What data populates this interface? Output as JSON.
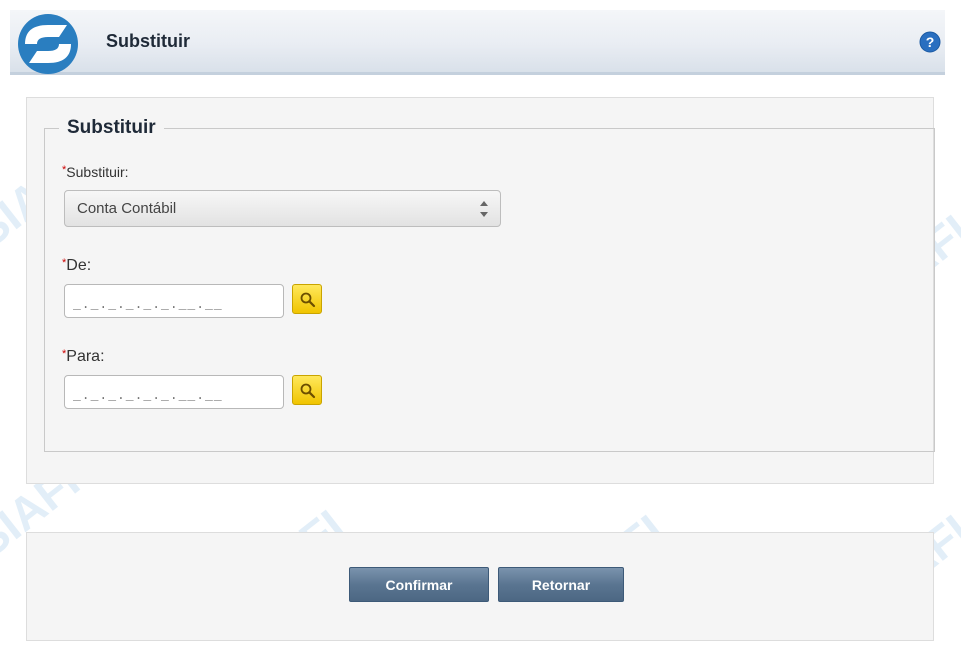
{
  "header": {
    "title": "Substituir"
  },
  "form": {
    "legend": "Substituir",
    "fields": {
      "substituir": {
        "label": "Substituir:",
        "value": "Conta Contábil"
      },
      "de": {
        "label": "De:",
        "mask": "_._._._._._.__.__"
      },
      "para": {
        "label": "Para:",
        "mask": "_._._._._._.__.__"
      }
    }
  },
  "actions": {
    "confirm": "Confirmar",
    "back": "Retornar"
  },
  "watermark": {
    "text": "SIAFI"
  },
  "theme": {
    "accent": "#2a7ec0",
    "button": "#5a7591",
    "required": "#cc0000",
    "search_button": "#f5cf1a"
  },
  "icons": {
    "logo": "siafi-logo-icon",
    "help": "help-icon",
    "search": "search-icon",
    "select_arrows": "select-arrows-icon"
  }
}
